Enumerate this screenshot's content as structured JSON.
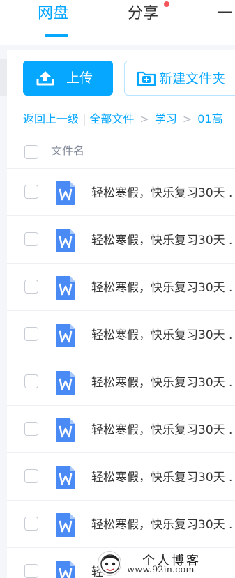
{
  "tabs": {
    "netdisk": "网盘",
    "share": "分享",
    "more": "一"
  },
  "actions": {
    "upload_label": "上传",
    "new_folder_label": "新建文件夹"
  },
  "breadcrumb": {
    "back": "返回上一级",
    "sep": "|",
    "all_files": "全部文件",
    "arrow": ">",
    "study": "学习",
    "current": "01高"
  },
  "table": {
    "column_name": "文件名"
  },
  "files": [
    {
      "name": "轻松寒假，快乐复习30天 ."
    },
    {
      "name": "轻松寒假，快乐复习30天 ."
    },
    {
      "name": "轻松寒假，快乐复习30天 ."
    },
    {
      "name": "轻松寒假，快乐复习30天 ."
    },
    {
      "name": "轻松寒假，快乐复习30天 ."
    },
    {
      "name": "轻松寒假，快乐复习30天 ."
    },
    {
      "name": "轻松寒假，快乐复习30天 ."
    },
    {
      "name": "轻松寒假，快乐复习30天 ."
    },
    {
      "name": "轻"
    }
  ],
  "watermark": {
    "title": "个人博客",
    "url": "www.92in.com"
  },
  "colors": {
    "accent": "#06a7ff",
    "doc_icon": "#4a8af4",
    "badge": "#f5555a"
  },
  "icons": {
    "upload": "upload-icon",
    "new_folder": "folder-plus-icon",
    "document": "word-doc-icon"
  }
}
